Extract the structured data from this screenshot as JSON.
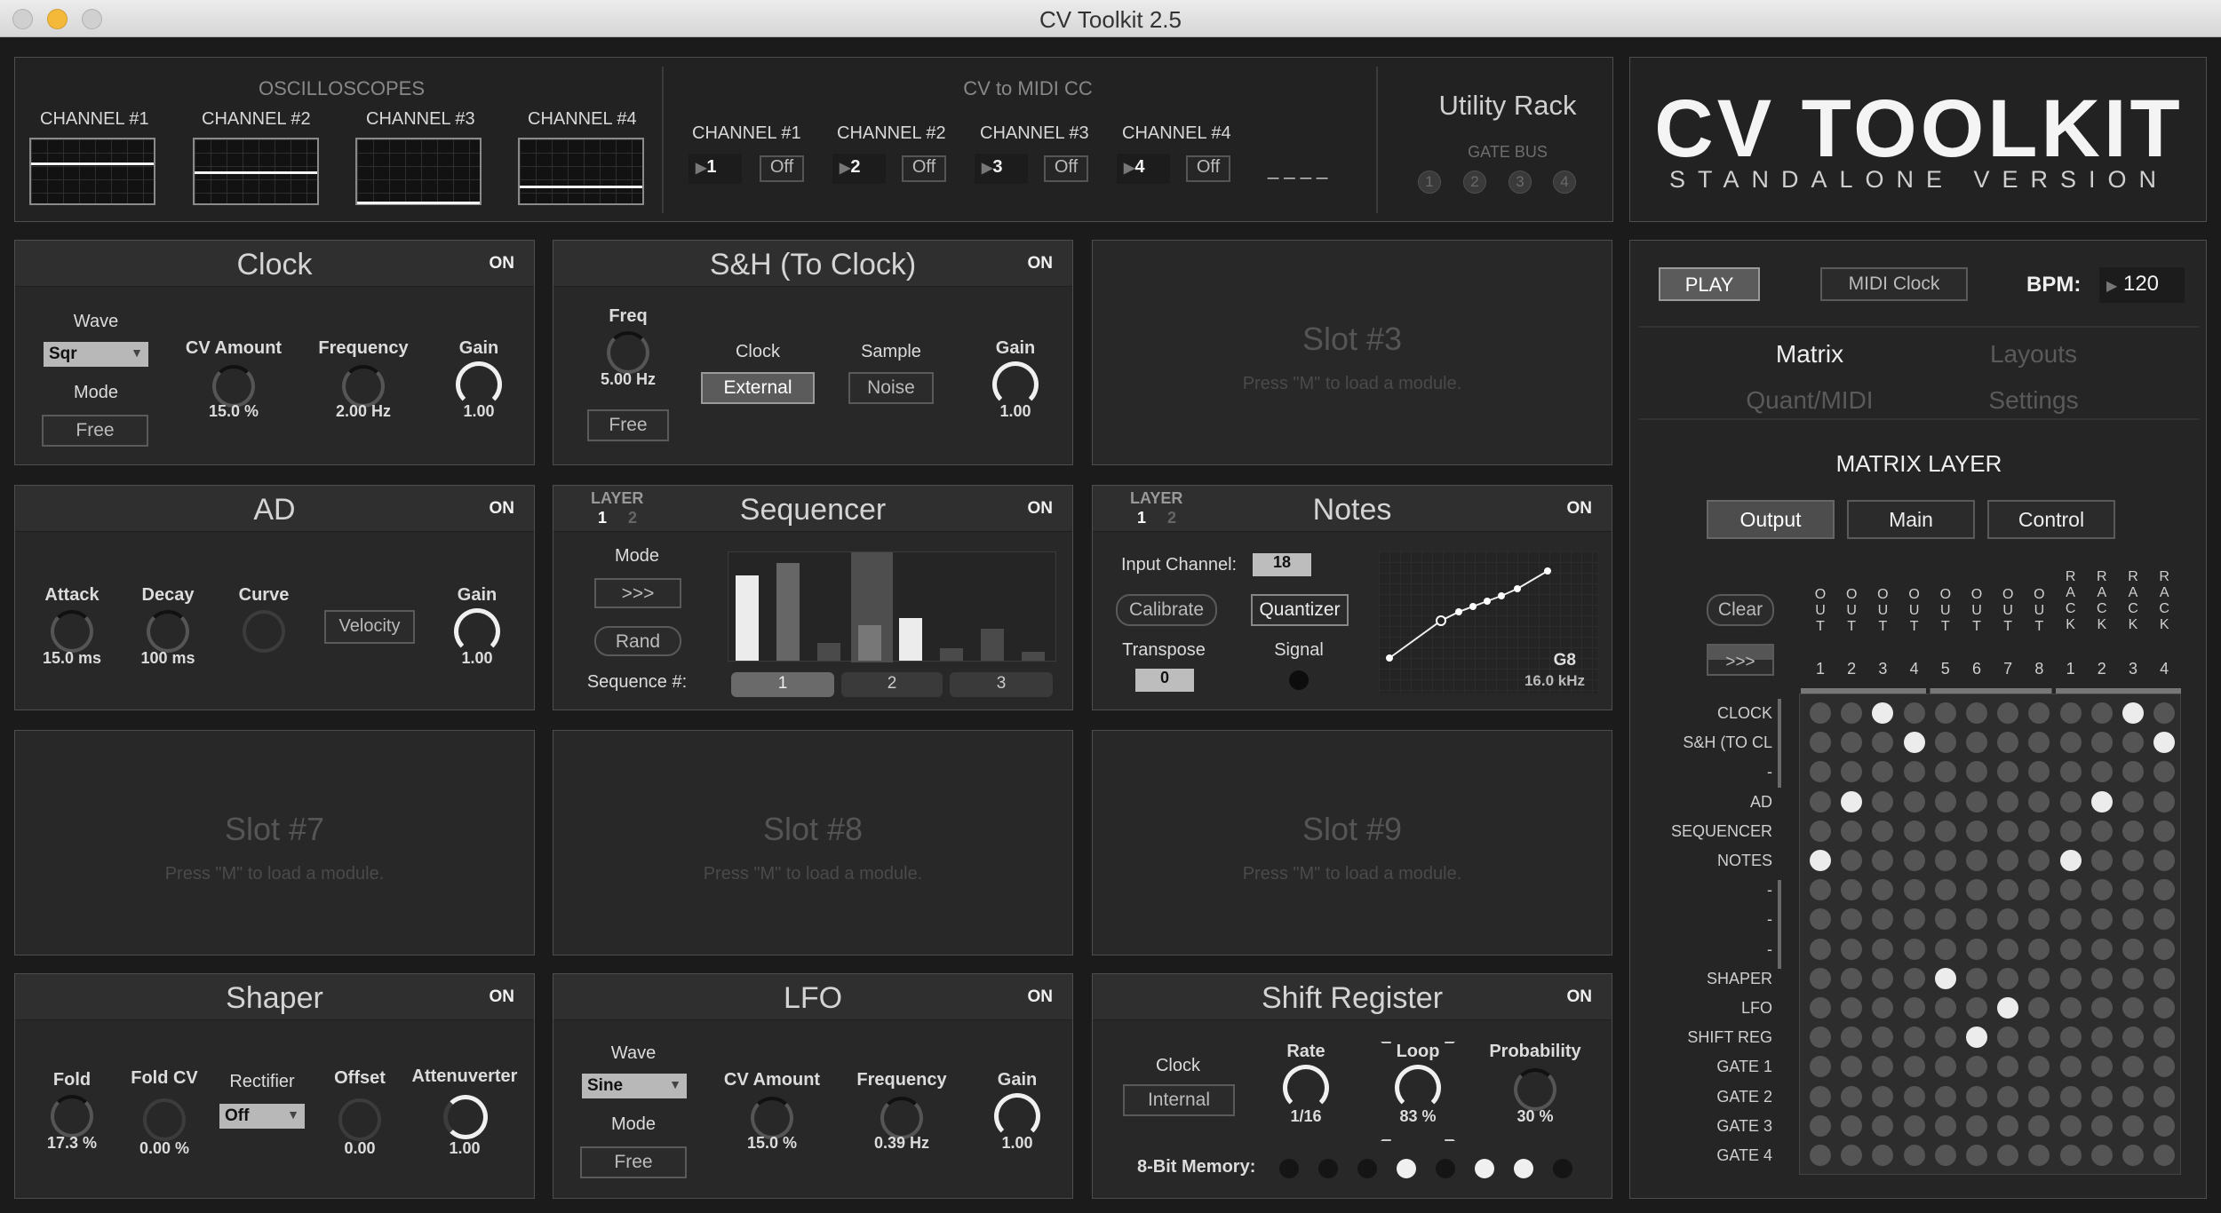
{
  "window": {
    "title": "CV Toolkit 2.5"
  },
  "scopes": {
    "title": "OSCILLOSCOPES",
    "channels": [
      "CHANNEL #1",
      "CHANNEL #2",
      "CHANNEL #3",
      "CHANNEL #4"
    ]
  },
  "midi": {
    "title": "CV to MIDI CC",
    "channels": [
      {
        "label": "CHANNEL #1",
        "num": "1",
        "off": "Off"
      },
      {
        "label": "CHANNEL #2",
        "num": "2",
        "off": "Off"
      },
      {
        "label": "CHANNEL #3",
        "num": "3",
        "off": "Off"
      },
      {
        "label": "CHANNEL #4",
        "num": "4",
        "off": "Off"
      }
    ],
    "dashes": "_ _ _ _"
  },
  "utility": {
    "title": "Utility Rack",
    "gatebus": "GATE BUS",
    "gates": [
      "1",
      "2",
      "3",
      "4"
    ]
  },
  "brand": {
    "title": "CV TOOLKIT",
    "subtitle": "STANDALONE VERSION"
  },
  "on": "ON",
  "clock": {
    "title": "Clock",
    "wave_label": "Wave",
    "wave": "Sqr",
    "mode_label": "Mode",
    "mode": "Free",
    "cv_label": "CV Amount",
    "cv": "15.0 %",
    "freq_label": "Frequency",
    "freq": "2.00 Hz",
    "gain_label": "Gain",
    "gain": "1.00"
  },
  "sh": {
    "title": "S&H (To Clock)",
    "freq_label": "Freq",
    "freq": "5.00 Hz",
    "mode": "Free",
    "clock_label": "Clock",
    "clock": "External",
    "sample_label": "Sample",
    "sample": "Noise",
    "gain_label": "Gain",
    "gain": "1.00"
  },
  "slot3": {
    "title": "Slot #3",
    "hint": "Press \"M\" to load a module."
  },
  "ad": {
    "title": "AD",
    "attack_label": "Attack",
    "attack": "15.0 ms",
    "decay_label": "Decay",
    "decay": "100 ms",
    "curve_label": "Curve",
    "velocity": "Velocity",
    "gain_label": "Gain",
    "gain": "1.00"
  },
  "seq": {
    "title": "Sequencer",
    "layer": "LAYER",
    "l1": "1",
    "l2": "2",
    "mode_label": "Mode",
    "mode": ">>>",
    "rand": "Rand",
    "seqnum_label": "Sequence #:",
    "seqs": [
      "1",
      "2",
      "3"
    ]
  },
  "notes": {
    "title": "Notes",
    "layer": "LAYER",
    "l1": "1",
    "l2": "2",
    "input_label": "Input Channel:",
    "input": "18",
    "calibrate": "Calibrate",
    "quantizer": "Quantizer",
    "transpose_label": "Transpose",
    "transpose": "0",
    "signal_label": "Signal",
    "note": "G8",
    "freq": "16.0 kHz"
  },
  "slot7": {
    "title": "Slot #7",
    "hint": "Press \"M\" to load a module."
  },
  "slot8": {
    "title": "Slot #8",
    "hint": "Press \"M\" to load a module."
  },
  "slot9": {
    "title": "Slot #9",
    "hint": "Press \"M\" to load a module."
  },
  "shaper": {
    "title": "Shaper",
    "fold_label": "Fold",
    "fold": "17.3 %",
    "foldcv_label": "Fold CV",
    "foldcv": "0.00 %",
    "rect_label": "Rectifier",
    "rect": "Off",
    "offset_label": "Offset",
    "offset": "0.00",
    "att_label": "Attenuverter",
    "att": "1.00"
  },
  "lfo": {
    "title": "LFO",
    "wave_label": "Wave",
    "wave": "Sine",
    "mode_label": "Mode",
    "mode": "Free",
    "cv_label": "CV Amount",
    "cv": "15.0 %",
    "freq_label": "Frequency",
    "freq": "0.39 Hz",
    "gain_label": "Gain",
    "gain": "1.00"
  },
  "shift": {
    "title": "Shift Register",
    "clock_label": "Clock",
    "clock": "Internal",
    "rate_label": "Rate",
    "rate": "1/16",
    "loop_label": "Loop",
    "loop": "83 %",
    "prob_label": "Probability",
    "prob": "30 %",
    "mem_label": "8-Bit Memory:",
    "mem": [
      0,
      0,
      0,
      1,
      0,
      1,
      1,
      0
    ]
  },
  "transport": {
    "play": "PLAY",
    "midiclock": "MIDI Clock",
    "bpm_label": "BPM:",
    "bpm": "120"
  },
  "tabs": {
    "matrix": "Matrix",
    "layouts": "Layouts",
    "quant": "Quant/MIDI",
    "settings": "Settings"
  },
  "matrix": {
    "title": "MATRIX LAYER",
    "output": "Output",
    "main": "Main",
    "control": "Control",
    "clear": "Clear",
    "arrows": ">>>",
    "cols": [
      {
        "t": "OUT",
        "n": "1"
      },
      {
        "t": "OUT",
        "n": "2"
      },
      {
        "t": "OUT",
        "n": "3"
      },
      {
        "t": "OUT",
        "n": "4"
      },
      {
        "t": "OUT",
        "n": "5"
      },
      {
        "t": "OUT",
        "n": "6"
      },
      {
        "t": "OUT",
        "n": "7"
      },
      {
        "t": "OUT",
        "n": "8"
      },
      {
        "t": "RACK",
        "n": "1"
      },
      {
        "t": "RACK",
        "n": "2"
      },
      {
        "t": "RACK",
        "n": "3"
      },
      {
        "t": "RACK",
        "n": "4"
      }
    ],
    "rows": [
      "CLOCK",
      "S&H (TO CL",
      "-",
      "AD",
      "SEQUENCER",
      "NOTES",
      "-",
      "-",
      "-",
      "SHAPER",
      "LFO",
      "SHIFT REG",
      "GATE 1",
      "GATE 2",
      "GATE 3",
      "GATE 4"
    ],
    "active": [
      [
        0,
        2
      ],
      [
        0,
        10
      ],
      [
        1,
        3
      ],
      [
        1,
        11
      ],
      [
        3,
        1
      ],
      [
        3,
        9
      ],
      [
        5,
        0
      ],
      [
        5,
        8
      ],
      [
        9,
        4
      ],
      [
        10,
        6
      ],
      [
        11,
        5
      ]
    ]
  }
}
